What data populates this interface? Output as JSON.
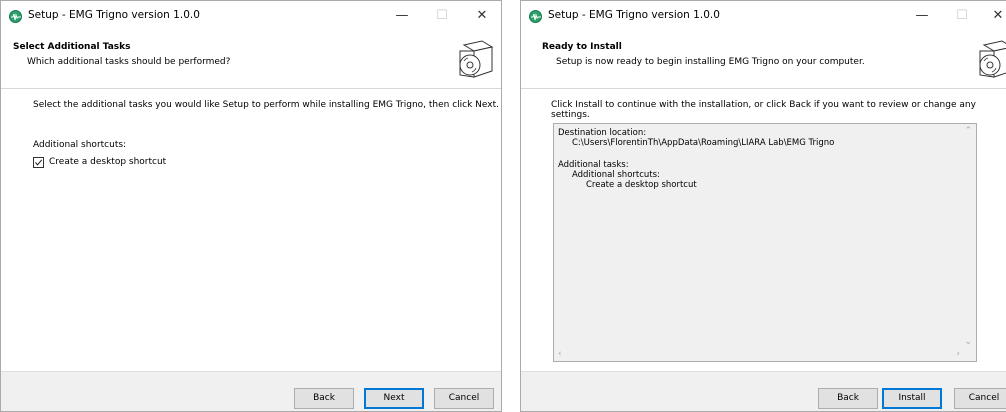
{
  "left_window": {
    "title": "Setup - EMG Trigno version 1.0.0",
    "header_title": "Select Additional Tasks",
    "header_subtitle": "Which additional tasks should be performed?",
    "intro": "Select the additional tasks you would like Setup to perform while installing EMG Trigno, then click Next.",
    "group_label": "Additional shortcuts:",
    "checkbox_label": "Create a desktop shortcut",
    "checkbox_checked": true,
    "buttons": {
      "back": "Back",
      "next": "Next",
      "cancel": "Cancel"
    }
  },
  "right_window": {
    "title": "Setup - EMG Trigno version 1.0.0",
    "header_title": "Ready to Install",
    "header_subtitle": "Setup is now ready to begin installing EMG Trigno on your computer.",
    "intro": "Click Install to continue with the installation, or click Back if you want to review or change any settings.",
    "memo": {
      "dest_label": "Destination location:",
      "dest_path": "C:\\Users\\FlorentinTh\\AppData\\Roaming\\LIARA Lab\\EMG Trigno",
      "tasks_label": "Additional tasks:",
      "tasks_group": "Additional shortcuts:",
      "tasks_item": "Create a desktop shortcut"
    },
    "buttons": {
      "back": "Back",
      "install": "Install",
      "cancel": "Cancel"
    }
  },
  "icons": {
    "app": "emg-wave-icon",
    "minimize": "minimize-icon",
    "maximize": "maximize-icon",
    "close": "close-icon",
    "header": "software-box-cd-icon"
  },
  "colors": {
    "accent": "#0078d7",
    "footer": "#f0f0f0",
    "app_icon": "#2a9f6a"
  }
}
